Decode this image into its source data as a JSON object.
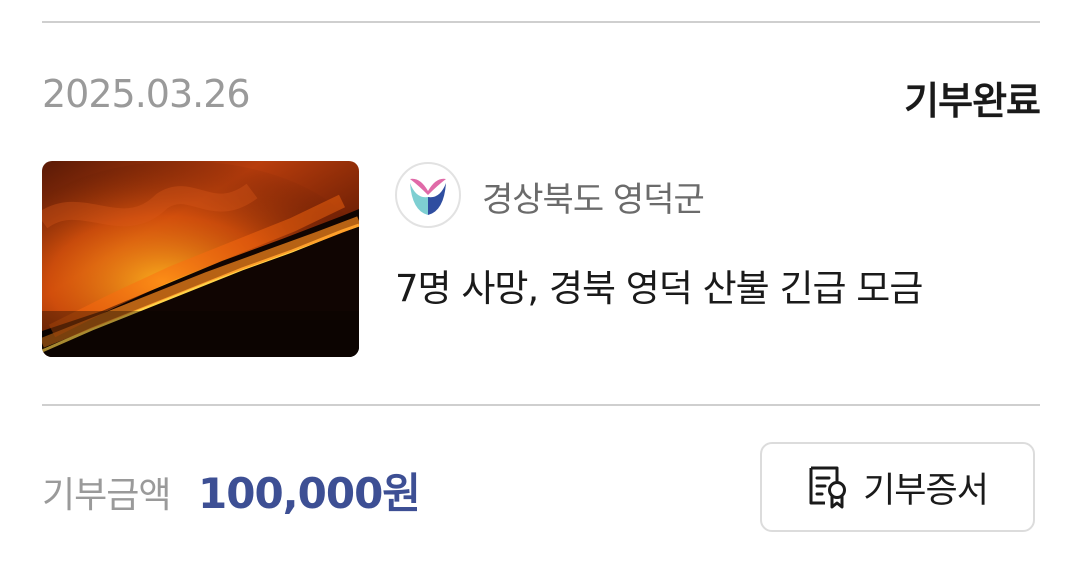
{
  "donation": {
    "date": "2025.03.26",
    "status": "기부완료",
    "organization": {
      "name": "경상북도 영덕군",
      "logo_icon": "yeongdeok-county-logo-icon"
    },
    "campaign": {
      "title": "7명 사망, 경북 영덕 산불 긴급 모금",
      "image": "wildfire-photo"
    },
    "amount": {
      "label": "기부금액",
      "value": "100,000원"
    },
    "certificate_button": {
      "label": "기부증서",
      "icon": "certificate-icon"
    }
  },
  "colors": {
    "accent": "#3d4f94",
    "muted_text": "#9a9a9a",
    "primary_text": "#1a1a1a",
    "divider": "#cfcfcf"
  }
}
